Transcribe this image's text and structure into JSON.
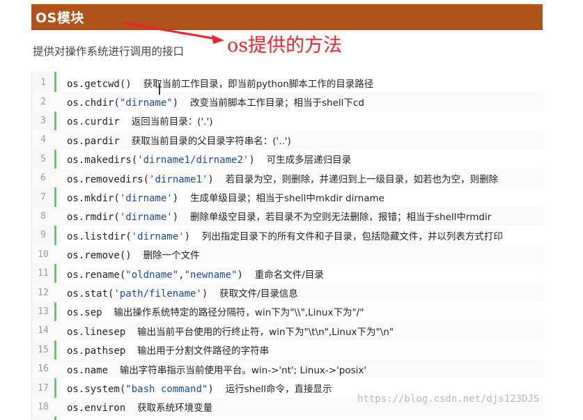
{
  "header": {
    "title": "OS模块"
  },
  "annotation": {
    "text": "os提供的方法"
  },
  "subtitle": "提供对操作系统进行调用的接口",
  "colors": {
    "header_bg": "#b0531a",
    "annotation": "#f0222a",
    "string": "#1a4aa0",
    "gutter_accent": "#6ac46a"
  },
  "code_lines": [
    {
      "num": "1",
      "code": "os.getcwd()",
      "desc": "获取当前工作目录，即当前python脚本工作的目录路径"
    },
    {
      "num": "2",
      "code": "os.chdir(\"dirname\")",
      "desc": "改变当前脚本工作目录；相当于shell下cd"
    },
    {
      "num": "3",
      "code": "os.curdir",
      "desc": "返回当前目录：('.')"
    },
    {
      "num": "4",
      "code": "os.pardir",
      "desc": "获取当前目录的父目录字符串名：('..')"
    },
    {
      "num": "5",
      "code": "os.makedirs('dirname1/dirname2')",
      "desc": "可生成多层递归目录"
    },
    {
      "num": "6",
      "code": "os.removedirs('dirname1')",
      "desc": "若目录为空，则删除，并递归到上一级目录，如若也为空，则删除"
    },
    {
      "num": "7",
      "code": "os.mkdir('dirname')",
      "desc": "生成单级目录；相当于shell中mkdir dirname"
    },
    {
      "num": "8",
      "code": "os.rmdir('dirname')",
      "desc": "删除单级空目录，若目录不为空则无法删除，报错；相当于shell中rmdir"
    },
    {
      "num": "9",
      "code": "os.listdir('dirname')",
      "desc": "列出指定目录下的所有文件和子目录，包括隐藏文件，并以列表方式打印"
    },
    {
      "num": "10",
      "code": "os.remove()",
      "desc": "删除一个文件"
    },
    {
      "num": "11",
      "code": "os.rename(\"oldname\",\"newname\")",
      "desc": "重命名文件/目录"
    },
    {
      "num": "12",
      "code": "os.stat('path/filename')",
      "desc": "获取文件/目录信息"
    },
    {
      "num": "13",
      "code": "os.sep",
      "desc": "输出操作系统特定的路径分隔符，win下为\"\\\\\",Linux下为\"/\""
    },
    {
      "num": "14",
      "code": "os.linesep",
      "desc": "输出当前平台使用的行终止符，win下为\"\\t\\n\",Linux下为\"\\n\""
    },
    {
      "num": "15",
      "code": "os.pathsep",
      "desc": "输出用于分割文件路径的字符串"
    },
    {
      "num": "16",
      "code": "os.name",
      "desc": "输出字符串指示当前使用平台。win->'nt'; Linux->'posix'"
    },
    {
      "num": "17",
      "code": "os.system(\"bash command\")",
      "desc": "运行shell命令，直接显示"
    },
    {
      "num": "18",
      "code": "os.environ",
      "desc": "获取系统环境变量"
    }
  ],
  "watermark": "https://blog.csdn.net/djs123DJS"
}
